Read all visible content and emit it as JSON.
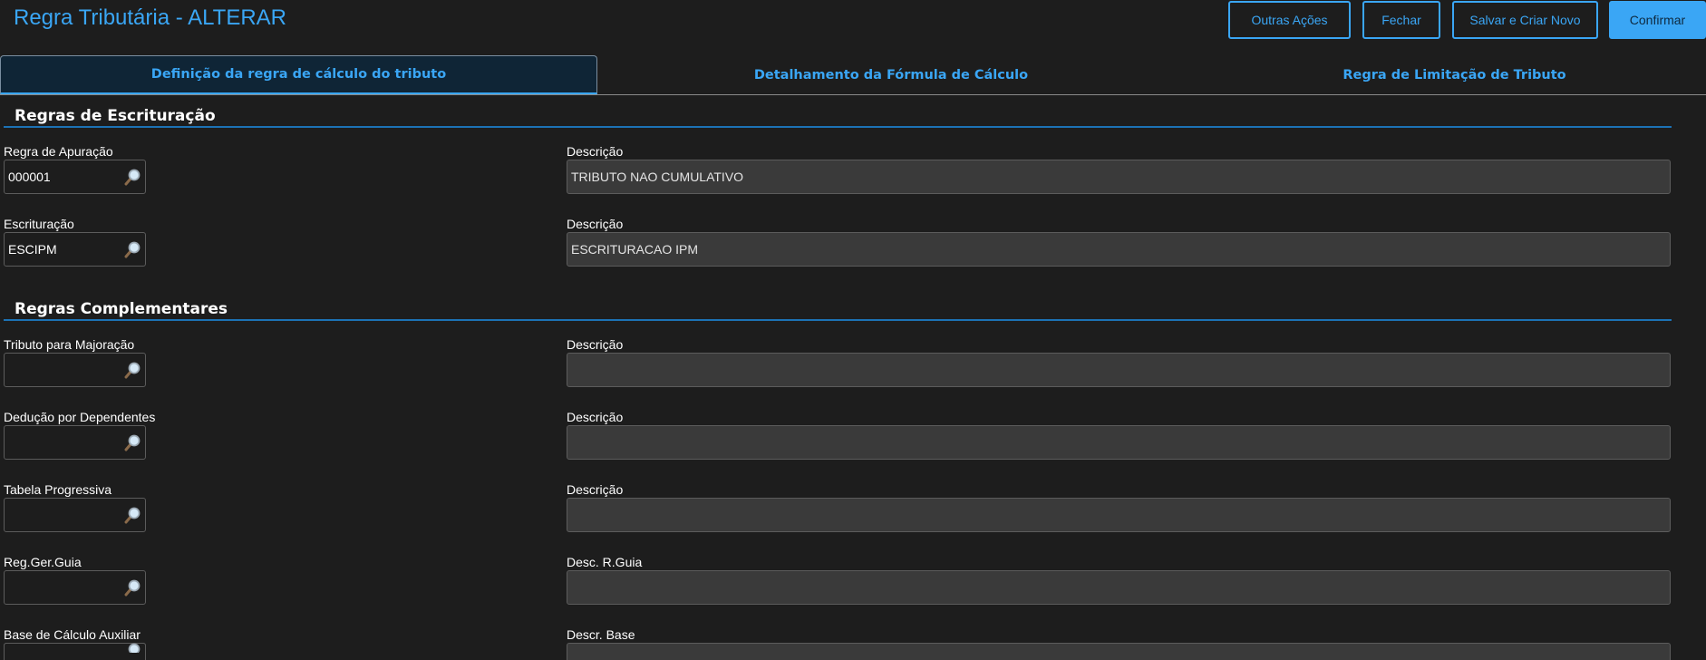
{
  "header": {
    "title": "Regra Tributária - ALTERAR",
    "buttons": {
      "outras_acoes": "Outras Ações",
      "fechar": "Fechar",
      "salvar_criar_novo": "Salvar e Criar Novo",
      "confirmar": "Confirmar"
    }
  },
  "tabs": [
    {
      "label": "Definição da regra de cálculo do tributo",
      "active": true
    },
    {
      "label": "Detalhamento da Fórmula de Cálculo",
      "active": false
    },
    {
      "label": "Regra de Limitação de Tributo",
      "active": false
    }
  ],
  "sections": {
    "escrituracao": {
      "title": "Regras de Escrituração",
      "regra_apuracao": {
        "label": "Regra de Apuração",
        "value": "000001",
        "desc_label": "Descrição",
        "desc_value": "TRIBUTO NAO CUMULATIVO"
      },
      "escrituracao": {
        "label": "Escrituração",
        "value": "ESCIPM",
        "desc_label": "Descrição",
        "desc_value": "ESCRITURACAO IPM"
      }
    },
    "complementares": {
      "title": "Regras Complementares",
      "tributo_majoracao": {
        "label": "Tributo para Majoração",
        "value": "",
        "desc_label": "Descrição",
        "desc_value": ""
      },
      "deducao_dependentes": {
        "label": "Dedução por Dependentes",
        "value": "",
        "desc_label": "Descrição",
        "desc_value": ""
      },
      "tabela_progressiva": {
        "label": "Tabela Progressiva",
        "value": "",
        "desc_label": "Descrição",
        "desc_value": ""
      },
      "reg_ger_guia": {
        "label": "Reg.Ger.Guia",
        "value": "",
        "desc_label": "Desc. R.Guia",
        "desc_value": ""
      },
      "base_calculo_aux": {
        "label": "Base de Cálculo Auxiliar",
        "value": "",
        "desc_label": "Descr. Base",
        "desc_value": ""
      }
    }
  },
  "icons": {
    "lookup": "magnifier-icon"
  },
  "colors": {
    "accent": "#3aa6f5",
    "background": "#1d1d1d",
    "section_rule": "#1c72b5",
    "readonly_field": "#3a3a3a"
  }
}
